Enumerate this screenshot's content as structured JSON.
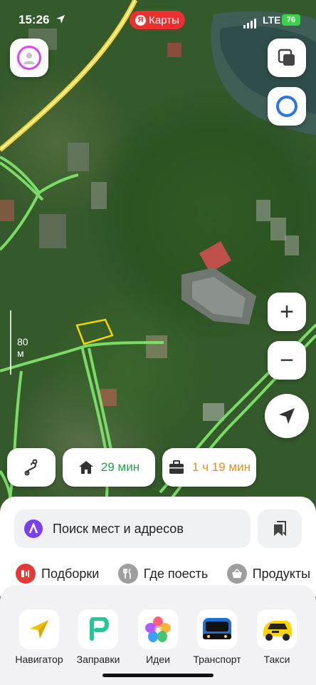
{
  "status_bar": {
    "time": "15:26",
    "network": "LTE",
    "battery": "76"
  },
  "app_pill": {
    "badge": "Я",
    "label": "Карты"
  },
  "map": {
    "scale_label": "80 м"
  },
  "controls": {
    "zoom_in": "+",
    "zoom_out": "−"
  },
  "routes": {
    "home_time": "29 мин",
    "work_time": "1 ч 19 мин",
    "home_color": "#1fa54a",
    "work_color": "#e39016"
  },
  "search": {
    "placeholder": "Поиск мест и адресов"
  },
  "quick_actions": [
    {
      "label": "Подборки",
      "icon": "collections-icon",
      "color": "#e53935"
    },
    {
      "label": "Где поесть",
      "icon": "cutlery-icon",
      "color": "#9e9e9e"
    },
    {
      "label": "Продукты",
      "icon": "basket-icon",
      "color": "#9e9e9e"
    }
  ],
  "nav": [
    {
      "label": "Навигатор",
      "icon": "navigator-icon"
    },
    {
      "label": "Заправки",
      "icon": "fuel-icon"
    },
    {
      "label": "Идеи",
      "icon": "ideas-icon"
    },
    {
      "label": "Транспорт",
      "icon": "bus-icon"
    },
    {
      "label": "Такси",
      "icon": "taxi-icon"
    }
  ],
  "colors": {
    "accent_red": "#ec2f2f",
    "alice_purple": "#7b3ff2",
    "road_green": "#7ee36a",
    "road_yellow": "#f2d43a"
  }
}
